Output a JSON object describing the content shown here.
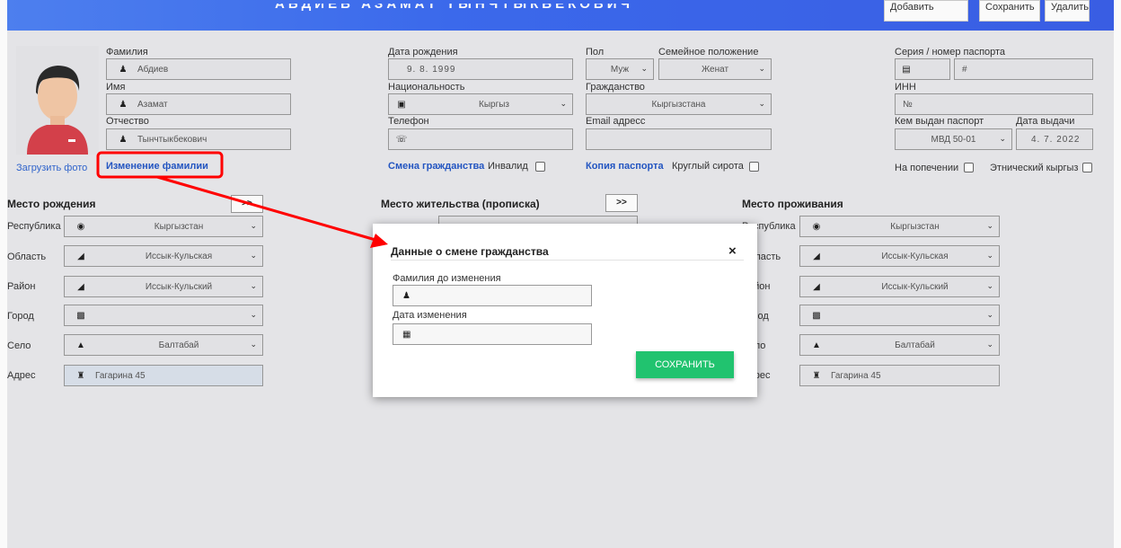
{
  "header": {
    "title": "АБДИЕВ АЗАМАТ ТЫНЧТЫКБЕКОВИЧ",
    "add_label": "Добавить нового",
    "save_label": "Сохранить",
    "delete_label": "Удалить"
  },
  "person": {
    "surname_label": "Фамилия",
    "surname_value": "Абдиев",
    "name_label": "Имя",
    "name_value": "Азамат",
    "patronymic_label": "Отчество",
    "patronymic_value": "Тынчтыкбекович",
    "upload_photo": "Загрузить фото",
    "change_surname": "Изменение фамилии",
    "birthdate_label": "Дата рождения",
    "birthdate_value": "9. 8. 1999",
    "nationality_label": "Национальность",
    "nationality_value": "Кыргыз",
    "phone_label": "Телефон",
    "change_citizenship": "Смена гражданства",
    "disabled_label": "Инвалид",
    "gender_label": "Пол",
    "gender_value": "Муж",
    "marital_label": "Семейное положение",
    "marital_value": "Женат",
    "citizenship_label": "Гражданство",
    "citizenship_value": "Кыргызстана",
    "email_label": "Email адресс",
    "passport_copy": "Копия паспорта",
    "orphan_label": "Круглый сирота",
    "passport_label": "Серия / номер паспорта",
    "passport_hash": "#",
    "inn_label": "ИНН",
    "inn_placeholder": "№",
    "issued_by_label": "Кем выдан паспорт",
    "issued_by_value": "МВД 50-01",
    "issue_date_label": "Дата выдачи",
    "issue_date_value": "4. 7. 2022",
    "guardianship_label": "На попечении",
    "ethnic_label": "Этнический кыргыз"
  },
  "birthplace": {
    "title": "Место рождения",
    "copy_btn": ">>",
    "republic_label": "Республика",
    "republic_value": "Кыргызстан",
    "region_label": "Область",
    "region_value": "Иссык-Кульская",
    "district_label": "Район",
    "district_value": "Иссык-Кульский",
    "city_label": "Город",
    "village_label": "Село",
    "village_value": "Балтабай",
    "address_label": "Адрес",
    "address_value": "Гагарина 45"
  },
  "registration": {
    "title": "Место жительства (прописка)",
    "copy_btn": ">>"
  },
  "residence": {
    "title": "Место проживания",
    "republic_label": "Республика",
    "republic_value": "Кыргызстан",
    "region_label": "Область",
    "region_value": "Иссык-Кульская",
    "district_label": "Район",
    "district_value": "Иссык-Кульский",
    "city_label": "Город",
    "village_label": "Село",
    "village_value": "Балтабай",
    "address_label": "Адрес",
    "address_value": "Гагарина 45"
  },
  "modal": {
    "title": "Данные о смене гражданства",
    "close": "×",
    "prev_surname_label": "Фамилия до изменения",
    "change_date_label": "Дата изменения",
    "save_label": "СОХРАНИТЬ"
  },
  "colors": {
    "accent": "#3d6cf0",
    "highlight": "#ff0000",
    "save": "#21c36f"
  }
}
